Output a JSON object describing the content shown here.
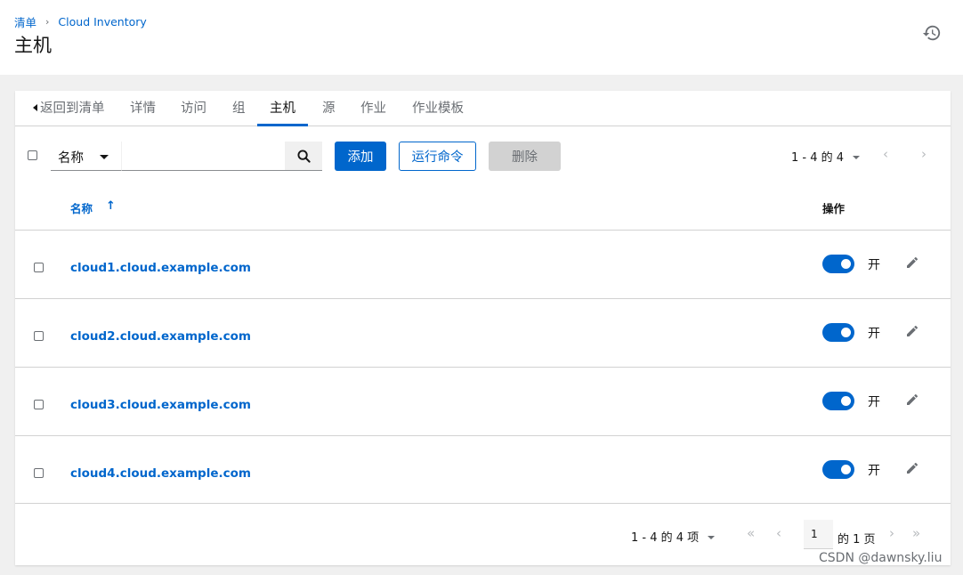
{
  "breadcrumb": {
    "root": "清单",
    "current": "Cloud Inventory"
  },
  "page_title": "主机",
  "tabs": [
    {
      "label": "返回到清单"
    },
    {
      "label": "详情"
    },
    {
      "label": "访问"
    },
    {
      "label": "组"
    },
    {
      "label": "主机"
    },
    {
      "label": "源"
    },
    {
      "label": "作业"
    },
    {
      "label": "作业模板"
    }
  ],
  "toolbar": {
    "filter_field": "名称",
    "search_placeholder": "",
    "add_label": "添加",
    "run_label": "运行命令",
    "delete_label": "删除",
    "pagination": "1 - 4 的 4"
  },
  "table": {
    "name_header": "名称",
    "actions_header": "操作",
    "rows": [
      {
        "name": "cloud1.cloud.example.com",
        "toggle_label": "开"
      },
      {
        "name": "cloud2.cloud.example.com",
        "toggle_label": "开"
      },
      {
        "name": "cloud3.cloud.example.com",
        "toggle_label": "开"
      },
      {
        "name": "cloud4.cloud.example.com",
        "toggle_label": "开"
      }
    ]
  },
  "bottom_pagination": {
    "range": "1 - 4 的 4 项",
    "page": "1",
    "of_pages": "的 1 页"
  },
  "watermark": "CSDN @dawnsky.liu",
  "colors": {
    "accent": "#0066cc",
    "disabled": "#d2d2d2"
  }
}
